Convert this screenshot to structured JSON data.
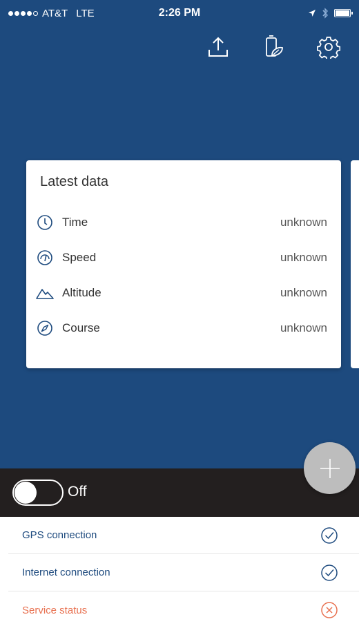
{
  "status_bar": {
    "carrier": "AT&T",
    "network": "LTE",
    "time": "2:26 PM",
    "signal_bars": 4,
    "signal_max": 5
  },
  "toolbar": {
    "upload_icon": "upload-icon",
    "battery_saver_icon": "battery-leaf-icon",
    "settings_icon": "gear-icon"
  },
  "card": {
    "title": "Latest data",
    "rows": [
      {
        "icon": "clock-icon",
        "label": "Time",
        "value": "unknown"
      },
      {
        "icon": "speedometer-icon",
        "label": "Speed",
        "value": "unknown"
      },
      {
        "icon": "mountain-icon",
        "label": "Altitude",
        "value": "unknown"
      },
      {
        "icon": "compass-icon",
        "label": "Course",
        "value": "unknown"
      }
    ]
  },
  "fab": {
    "icon": "plus-icon"
  },
  "toggle": {
    "label": "Off",
    "on": false
  },
  "status_list": [
    {
      "label": "GPS connection",
      "state": "ok",
      "icon": "check-circle-icon"
    },
    {
      "label": "Internet connection",
      "state": "ok",
      "icon": "check-circle-icon"
    },
    {
      "label": "Service status",
      "state": "error",
      "icon": "x-circle-icon"
    }
  ],
  "colors": {
    "primary": "#1d4a7e",
    "dark_bar": "#231f1f",
    "error": "#e8704f",
    "fab": "#bdbdbd"
  }
}
